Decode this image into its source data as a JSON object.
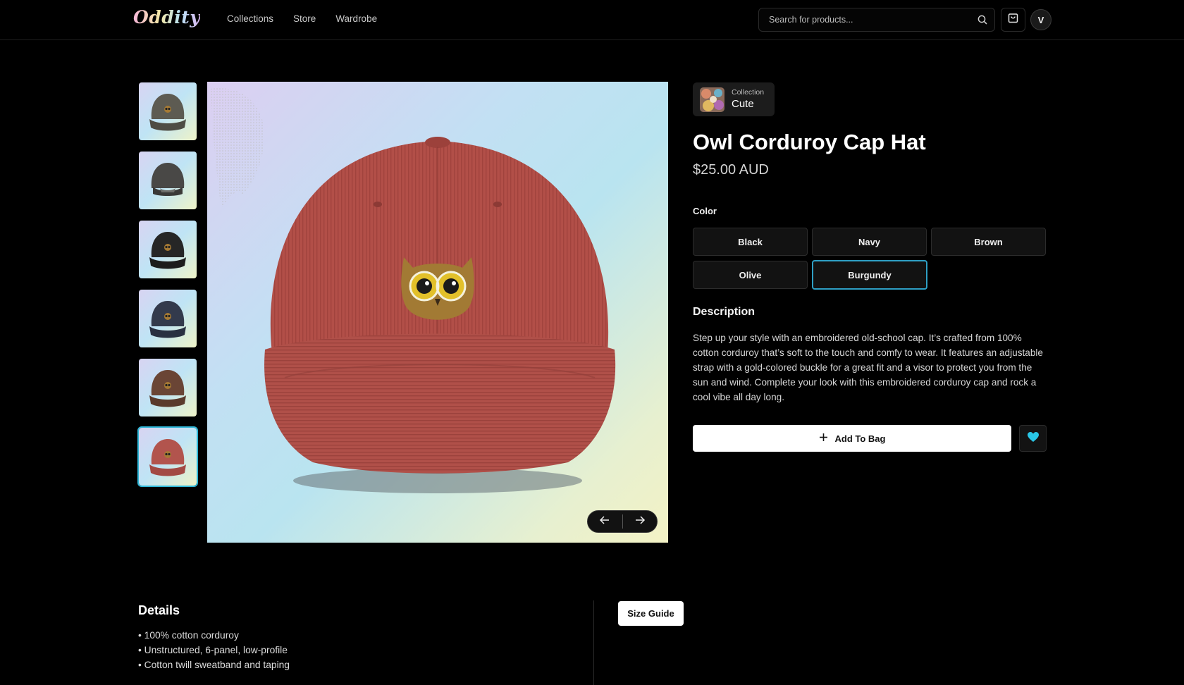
{
  "nav": {
    "logo": "Oddity",
    "links": [
      "Collections",
      "Store",
      "Wardrobe"
    ],
    "search_placeholder": "Search for products...",
    "avatar_initial": "V"
  },
  "gallery": {
    "thumbnail_colors": [
      "Olive",
      "Black",
      "Black",
      "Navy",
      "Brown",
      "Burgundy"
    ],
    "active_index": 5
  },
  "product": {
    "collection_label": "Collection",
    "collection_name": "Cute",
    "title": "Owl Corduroy Cap Hat",
    "price": "$25.00 AUD",
    "color_label": "Color",
    "colors": [
      "Black",
      "Navy",
      "Brown",
      "Olive",
      "Burgundy"
    ],
    "selected_color": "Burgundy",
    "description_heading": "Description",
    "description": "Step up your style with an embroidered old-school cap. It’s crafted from 100% cotton corduroy that’s soft to the touch and comfy to wear. It features an adjustable strap with a gold-colored buckle for a great fit and a visor to protect you from the sun and wind. Complete your look with this embroidered corduroy cap and rock a cool vibe all day long.",
    "add_to_bag": "Add To Bag"
  },
  "details": {
    "heading": "Details",
    "items": [
      "• 100% cotton corduroy",
      "• Unstructured, 6-panel, low-profile",
      "• Cotton twill sweatband and taping"
    ],
    "size_guide": "Size Guide"
  },
  "colors": {
    "accent": "#2fb7d8",
    "heart": "#29c6e6"
  }
}
